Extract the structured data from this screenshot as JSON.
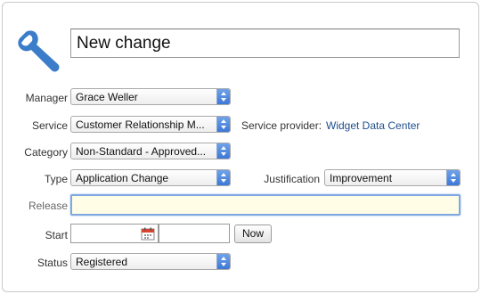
{
  "title": {
    "value": "New change"
  },
  "fields": {
    "manager": {
      "label": "Manager",
      "value": "Grace Weller"
    },
    "service": {
      "label": "Service",
      "value": "Customer Relationship M..."
    },
    "service_provider": {
      "label": "Service provider:",
      "value": "Widget Data Center"
    },
    "category": {
      "label": "Category",
      "value": "Non-Standard - Approved..."
    },
    "type": {
      "label": "Type",
      "value": "Application Change"
    },
    "justification": {
      "label": "Justification",
      "value": "Improvement"
    },
    "release": {
      "label": "Release",
      "value": ""
    },
    "start": {
      "label": "Start",
      "date_value": "",
      "time_value": "",
      "now_label": "Now"
    },
    "status": {
      "label": "Status",
      "value": "Registered"
    }
  },
  "icons": {
    "header": "wrench-icon",
    "calendar": "calendar-icon",
    "select": "stepper-arrows-icon"
  },
  "colors": {
    "accent": "#3b7dc9",
    "link": "#1f4e8c",
    "release_focus_bg": "#fffde6",
    "release_focus_border": "#7fa7e0"
  }
}
